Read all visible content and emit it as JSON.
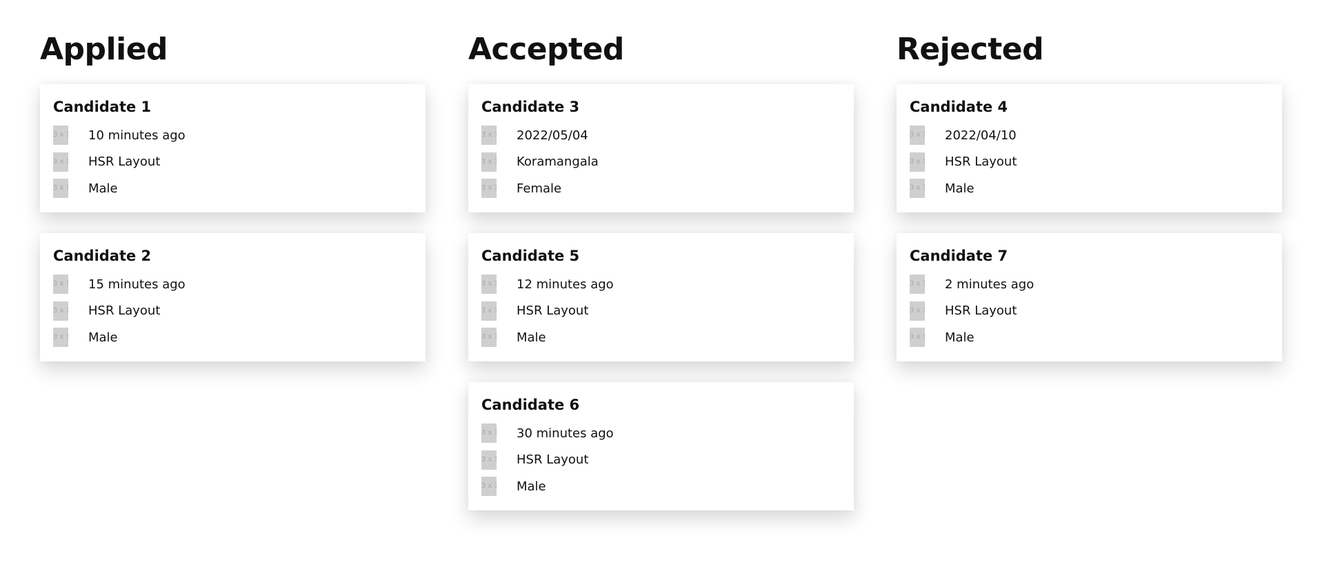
{
  "columns": [
    {
      "title": "Applied",
      "cards": [
        {
          "name": "Candidate 1",
          "time": "10 minutes ago",
          "location": "HSR Layout",
          "gender": "Male"
        },
        {
          "name": "Candidate 2",
          "time": "15 minutes ago",
          "location": "HSR Layout",
          "gender": "Male"
        }
      ]
    },
    {
      "title": "Accepted",
      "cards": [
        {
          "name": "Candidate 3",
          "time": "2022/05/04",
          "location": "Koramangala",
          "gender": "Female"
        },
        {
          "name": "Candidate 5",
          "time": "12 minutes ago",
          "location": "HSR Layout",
          "gender": "Male"
        },
        {
          "name": "Candidate 6",
          "time": "30 minutes ago",
          "location": "HSR Layout",
          "gender": "Male"
        }
      ]
    },
    {
      "title": "Rejected",
      "cards": [
        {
          "name": "Candidate 4",
          "time": "2022/04/10",
          "location": "HSR Layout",
          "gender": "Male"
        },
        {
          "name": "Candidate 7",
          "time": "2 minutes ago",
          "location": "HSR Layout",
          "gender": "Male"
        }
      ]
    }
  ],
  "placeholder_icon": {
    "label": "3 x 1",
    "name": "placeholder-image-icon",
    "color": "#cfcfcf"
  }
}
